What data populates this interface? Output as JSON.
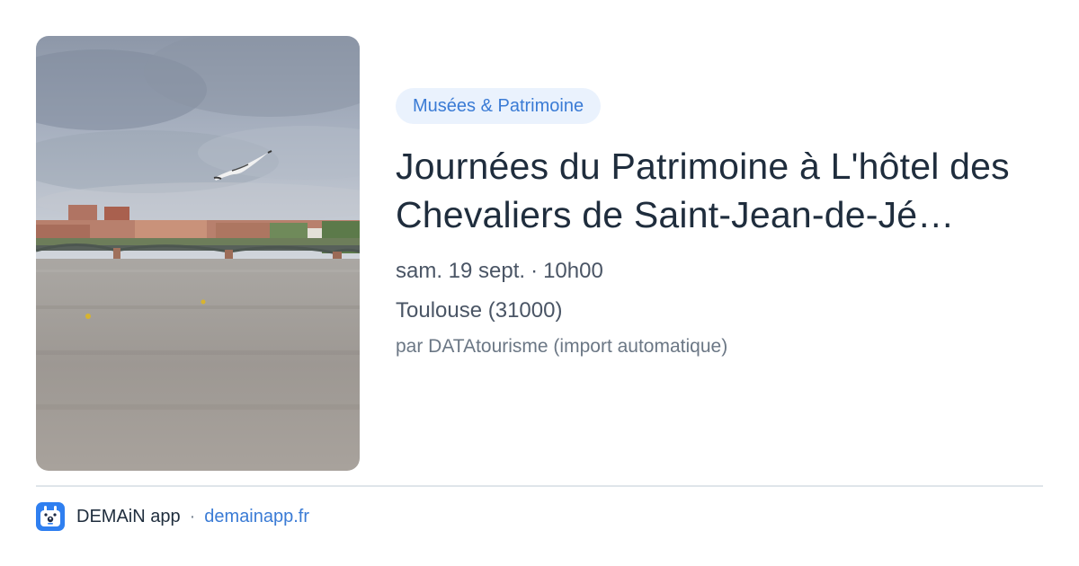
{
  "event": {
    "image_alt": "Seagull flying over the Garonne and Pont Saint-Pierre, Toulouse",
    "category": "Musées & Patrimoine",
    "title": "Journées du Patrimoine à L'hôtel des Chevaliers de Saint-Jean-de-Jé…",
    "date": "sam. 19 sept.",
    "separator": "·",
    "time": "10h00",
    "location": "Toulouse (31000)",
    "source": "par DATAtourisme (import automatique)"
  },
  "footer": {
    "app_icon": "app-logo-icon",
    "app_name": "DEMAiN app",
    "separator": "·",
    "domain": "demainapp.fr"
  },
  "colors": {
    "accent": "#3a7bd5",
    "chip_background": "#eaf2fd",
    "title": "#1f2d3d",
    "meta_text": "#4a5565",
    "divider": "#dfe5ea"
  }
}
